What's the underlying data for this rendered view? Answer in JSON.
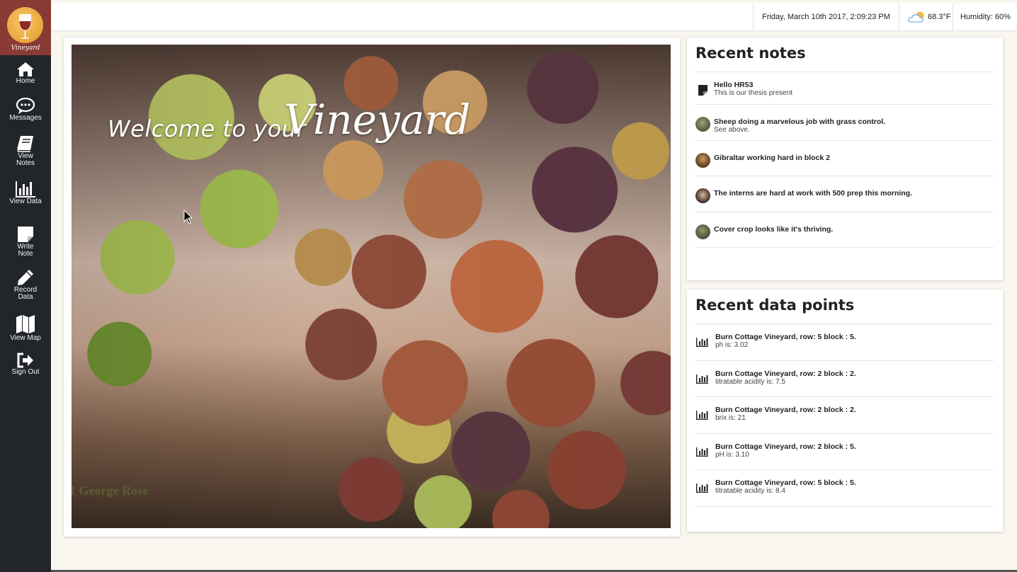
{
  "app": {
    "logo_text": "Vineyard"
  },
  "sidebar": {
    "items": [
      {
        "label_line1": "Home",
        "label_line2": "",
        "icon": "home-icon"
      },
      {
        "label_line1": "Messages",
        "label_line2": "",
        "icon": "chat-icon"
      },
      {
        "label_line1": "View",
        "label_line2": "Notes",
        "icon": "book-icon"
      },
      {
        "label_line1": "View Data",
        "label_line2": "",
        "icon": "bar-chart-icon"
      },
      {
        "label_line1": "Write",
        "label_line2": "Note",
        "icon": "sticky-note-icon"
      },
      {
        "label_line1": "Record",
        "label_line2": "Data",
        "icon": "pencil-icon"
      },
      {
        "label_line1": "View Map",
        "label_line2": "",
        "icon": "map-icon"
      },
      {
        "label_line1": "Sign Out",
        "label_line2": "",
        "icon": "sign-out-icon"
      }
    ]
  },
  "topbar": {
    "datetime": "Friday, March 10th 2017, 2:09:23 PM",
    "temperature": "68.3°F",
    "weather_icon": "partly-cloudy-icon",
    "humidity": "Humidity: 60%"
  },
  "hero": {
    "welcome": "Welcome to your",
    "title": "Vineyard",
    "photo_credit": "1 George Rose"
  },
  "notes": {
    "title": "Recent notes",
    "items": [
      {
        "title": "Hello HR53",
        "subtitle": "This is our thesis present"
      },
      {
        "title": "Sheep doing a marvelous job with grass control.",
        "subtitle": "See above."
      },
      {
        "title": "Gibraltar working hard in block 2",
        "subtitle": ""
      },
      {
        "title": "The interns are hard at work with 500 prep this morning.",
        "subtitle": ""
      },
      {
        "title": "Cover crop looks like it's thriving.",
        "subtitle": ""
      }
    ]
  },
  "data_points": {
    "title": "Recent data points",
    "items": [
      {
        "title": "Burn Cottage Vineyard, row: 5 block : 5.",
        "subtitle": "ph is: 3.02"
      },
      {
        "title": "Burn Cottage Vineyard, row: 2 block : 2.",
        "subtitle": "titratable acidity is: 7.5"
      },
      {
        "title": "Burn Cottage Vineyard, row: 2 block : 2.",
        "subtitle": "brix is: 21"
      },
      {
        "title": "Burn Cottage Vineyard, row: 2 block : 5.",
        "subtitle": "pH is: 3.10"
      },
      {
        "title": "Burn Cottage Vineyard, row: 5 block : 5.",
        "subtitle": "titratable acidity is: 8.4"
      }
    ]
  },
  "colors": {
    "sidebar_bg": "#22262a",
    "logo_bg": "#8a3a34",
    "page_bg": "#f8f6ef"
  }
}
